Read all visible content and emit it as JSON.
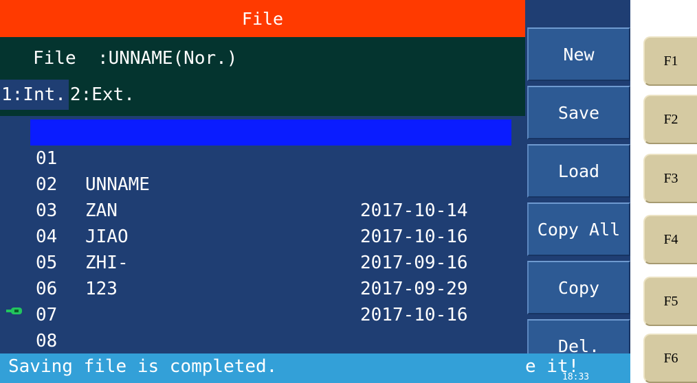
{
  "title": "File",
  "file_info": {
    "label": "File",
    "value": ":UNNAME(Nor.)"
  },
  "tabs": [
    {
      "label": "1:Int.",
      "active": true
    },
    {
      "label": "2:Ext.",
      "active": false
    }
  ],
  "files": [
    {
      "num": "01",
      "name": "UNNAME",
      "date": "2017-10-14",
      "selected": true
    },
    {
      "num": "02",
      "name": "ZAN",
      "date": "2017-10-16"
    },
    {
      "num": "03",
      "name": "JIAO",
      "date": "2017-09-16"
    },
    {
      "num": "04",
      "name": "ZHI-",
      "date": "2017-09-29"
    },
    {
      "num": "05",
      "name": "123",
      "date": "2017-10-16"
    },
    {
      "num": "06",
      "name": "",
      "date": ""
    },
    {
      "num": "07",
      "name": "",
      "date": ""
    },
    {
      "num": "08",
      "name": "",
      "date": ""
    }
  ],
  "softkeys": [
    "New",
    "Save",
    "Load",
    "Copy All",
    "Copy",
    "Del."
  ],
  "fkeys": [
    "F1",
    "F2",
    "F3",
    "F4",
    "F5",
    "F6"
  ],
  "status": {
    "message": "Saving file is completed.",
    "tail": "e it!",
    "time": "18:33"
  },
  "icons": {
    "usb": "usb-drive-icon"
  },
  "colors": {
    "title_bar": "#ff3a00",
    "info_panel": "#04342f",
    "screen_bg": "#1f3e73",
    "selection": "#0a1cff",
    "status_bar": "#33a0d8",
    "softkey": "#2d5a94",
    "hardkey": "#d5caa2",
    "usb_icon": "#22c55e"
  }
}
